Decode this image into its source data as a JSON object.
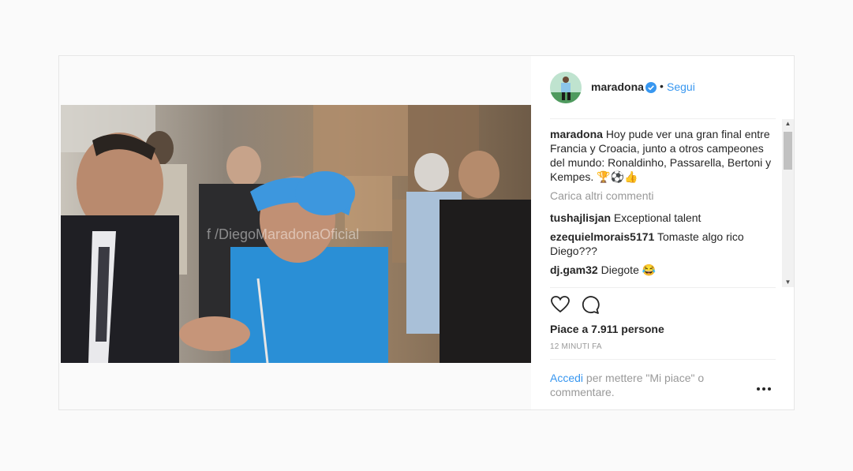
{
  "post": {
    "username": "maradona",
    "separator": "•",
    "follow_label": "Segui",
    "video_watermark": "f /DiegoMaradonaOficial",
    "caption": {
      "user": "maradona",
      "text": "Hoy pude ver una gran final entre Francia y Croacia, junto a otros campeones del mundo: Ronaldinho, Passarella, Bertoni y Kempes. 🏆⚽👍"
    },
    "load_more_label": "Carica altri commenti",
    "comments": [
      {
        "user": "tushajlisjan",
        "text": "Exceptional talent"
      },
      {
        "user": "ezequielmorais5171",
        "text": "Tomaste algo rico Diego???"
      },
      {
        "user": "dj.gam32",
        "text": "Diegote 😂"
      }
    ],
    "likes_text": "Piace a 7.911 persone",
    "timestamp": "12 minuti fa",
    "login_link": "Accedi",
    "login_text": " per mettere \"Mi piace\" o commentare."
  },
  "icons": {
    "like": "heart-icon",
    "comment": "comment-icon",
    "verified": "verified-badge-icon",
    "more": "more-options-icon"
  },
  "colors": {
    "link": "#3897f0",
    "muted": "#999999",
    "text": "#262626",
    "background": "#fafafa"
  }
}
